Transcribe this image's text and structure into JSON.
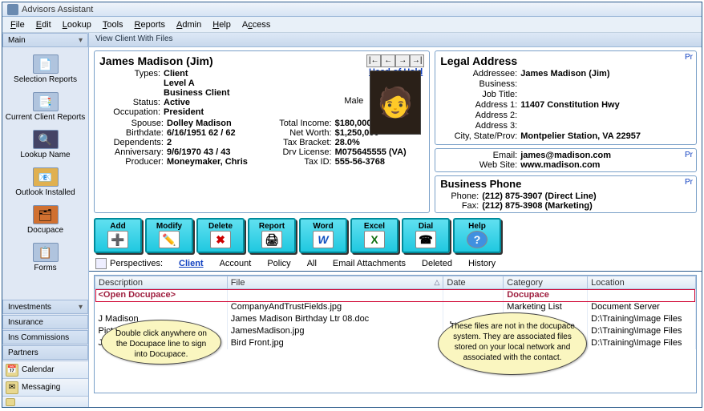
{
  "window": {
    "title": "Advisors Assistant"
  },
  "menu": [
    "File",
    "Edit",
    "Lookup",
    "Tools",
    "Reports",
    "Admin",
    "Help",
    "Access"
  ],
  "sidebar": {
    "main_tab": "Main",
    "items": [
      {
        "label": "Selection Reports",
        "icon": "📄"
      },
      {
        "label": "Current Client Reports",
        "icon": "📑"
      },
      {
        "label": "Lookup Name",
        "icon": "🔍"
      },
      {
        "label": "Outlook Installed",
        "icon": "📧"
      },
      {
        "label": "Docupace",
        "icon": "🗂"
      },
      {
        "label": "Forms",
        "icon": "📋"
      }
    ],
    "stack": [
      "Investments",
      "Insurance",
      "Ins Commissions",
      "Partners"
    ],
    "bottom": [
      {
        "label": "Calendar",
        "icon": "📅"
      },
      {
        "label": "Messaging",
        "icon": "✉"
      },
      {
        "label": "",
        "icon": "⋯"
      }
    ]
  },
  "view_header": "View Client With Files",
  "client": {
    "name": "James Madison (Jim)",
    "head_link": "Head of Hsld",
    "gender": "Male",
    "types_label": "Types:",
    "types": [
      "Client",
      "Level A",
      "Business Client"
    ],
    "status_label": "Status:",
    "status": "Active",
    "occupation_label": "Occupation:",
    "occupation": "President",
    "spouse_label": "Spouse:",
    "spouse": "Dolley Madison",
    "birthdate_label": "Birthdate:",
    "birthdate": "6/16/1951  62 / 62",
    "dependents_label": "Dependents:",
    "dependents": "2",
    "anniversary_label": "Anniversary:",
    "anniversary": "9/6/1970  43 / 43",
    "producer_label": "Producer:",
    "producer": "Moneymaker, Chris",
    "total_income_label": "Total Income:",
    "total_income": "$180,000",
    "net_worth_label": "Net Worth:",
    "net_worth": "$1,250,000",
    "tax_bracket_label": "Tax Bracket:",
    "tax_bracket": "28.0%",
    "drv_license_label": "Drv License:",
    "drv_license": "M075645555 (VA)",
    "tax_id_label": "Tax ID:",
    "tax_id": "555-56-3768"
  },
  "legal": {
    "title": "Legal Address",
    "prefs": "Pr",
    "addressee_label": "Addressee:",
    "addressee": "James Madison (Jim)",
    "business_label": "Business:",
    "business": "",
    "jobtitle_label": "Job Title:",
    "jobtitle": "",
    "addr1_label": "Address 1:",
    "addr1": "11407 Constitution Hwy",
    "addr2_label": "Address 2:",
    "addr2": "",
    "addr3_label": "Address 3:",
    "addr3": "",
    "city_label": "City, State/Prov:",
    "city": "Montpelier Station,  VA  22957"
  },
  "contact": {
    "email_label": "Email:",
    "email": "james@madison.com",
    "website_label": "Web Site:",
    "website": "www.madison.com",
    "prefs": "Pr"
  },
  "phone": {
    "title": "Business Phone",
    "phone_label": "Phone:",
    "phone": "(212) 875-3907  (Direct Line)",
    "fax_label": "Fax:",
    "fax": "(212) 875-3908  (Marketing)",
    "prefs": "Pr"
  },
  "toolbar": [
    {
      "label": "Add",
      "icon": "➕"
    },
    {
      "label": "Modify",
      "icon": "✏️"
    },
    {
      "label": "Delete",
      "icon": "✖"
    },
    {
      "label": "Report",
      "icon": "🖨"
    },
    {
      "label": "Word",
      "icon": "W"
    },
    {
      "label": "Excel",
      "icon": "X"
    },
    {
      "label": "Dial",
      "icon": "☎"
    },
    {
      "label": "Help",
      "icon": "?"
    }
  ],
  "perspectives": {
    "label": "Perspectives:",
    "tabs": [
      "Client",
      "Account",
      "Policy",
      "All",
      "Email Attachments",
      "Deleted",
      "History"
    ],
    "active": "Client"
  },
  "table": {
    "cols": [
      "Description",
      "File",
      "Date",
      "Category",
      "Location"
    ],
    "rows": [
      {
        "desc": "<Open Docupace>",
        "file": "",
        "date": "",
        "cat": "Docupace",
        "loc": ""
      },
      {
        "desc": "",
        "file": "CompanyAndTrustFields.jpg",
        "date": "",
        "cat": "Marketing List",
        "loc": "Document Server"
      },
      {
        "desc": "J Madison",
        "file": "James Madison Birthday Ltr 08.doc",
        "date": "",
        "cat": "",
        "loc": "D:\\Training\\Image Files"
      },
      {
        "desc": "Picture",
        "file": "JamesMadison.jpg",
        "date": "",
        "cat": "",
        "loc": "D:\\Training\\Image Files"
      },
      {
        "desc": "Jim's House",
        "file": "Bird Front.jpg",
        "date": "",
        "cat": "",
        "loc": "D:\\Training\\Image Files"
      }
    ]
  },
  "callouts": {
    "b1": "Double click anywhere on the Docupace line to sign into Docupace.",
    "b2": "These files are not in the docupace system.  They are associated files stored on your local network and associated with the contact."
  }
}
